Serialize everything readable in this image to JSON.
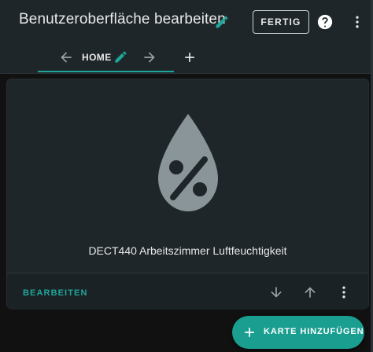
{
  "header": {
    "title": "Benutzeroberfläche bearbeiten",
    "done_label": "FERTIG"
  },
  "tabs": {
    "active_label": "HOME"
  },
  "card": {
    "sensor_name": "DECT440 Arbeitszimmer Luftfeuchtigkeit",
    "icon": "water-percent-icon",
    "edit_label": "BEARBEITEN"
  },
  "fab": {
    "label": "KARTE HINZUFÜGEN"
  },
  "colors": {
    "accent": "#1fa69a",
    "header_bg": "#1e2629",
    "card_bg": "#1e2629",
    "page_bg": "#111111",
    "icon_grey": "#8a9599"
  }
}
